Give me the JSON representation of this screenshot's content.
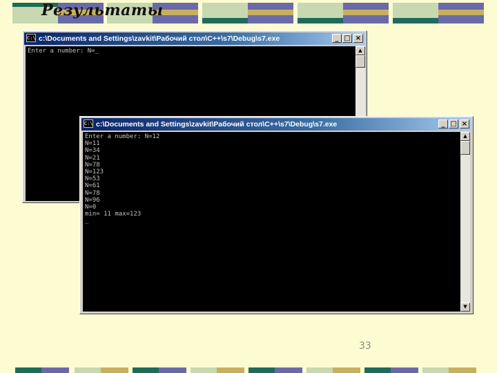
{
  "slide": {
    "title": "Результаты",
    "page_number": "33"
  },
  "windows": {
    "back": {
      "title": "c:\\Documents and Settings\\zavkit\\Рабочий стол\\C++\\s7\\Debug\\s7.exe",
      "icon_text": "C:\\",
      "buttons": {
        "minimize": "_",
        "maximize": "□",
        "close": "×"
      },
      "console_text": "Enter a number: N=_"
    },
    "front": {
      "title": "c:\\Documents and Settings\\zavkit\\Рабочий стол\\C++\\s7\\Debug\\s7.exe",
      "icon_text": "C:\\",
      "buttons": {
        "minimize": "_",
        "maximize": "□",
        "close": "×"
      },
      "console_text": "Enter a number: N=12\nN=11\nN=34\nN=21\nN=78\nN=123\nN=53\nN=61\nN=78\nN=96\nN=0\nmin= 11 max=123\n_"
    },
    "scroll_arrows": {
      "up": "▲",
      "down": "▼"
    }
  },
  "colors": {
    "background": "#fdfbd2",
    "deco_green": "#1e6b5a",
    "deco_purple": "#6a6aa8",
    "deco_light": "#c8d8b0",
    "deco_gold": "#c8b060",
    "titlebar": "#0a246a"
  }
}
